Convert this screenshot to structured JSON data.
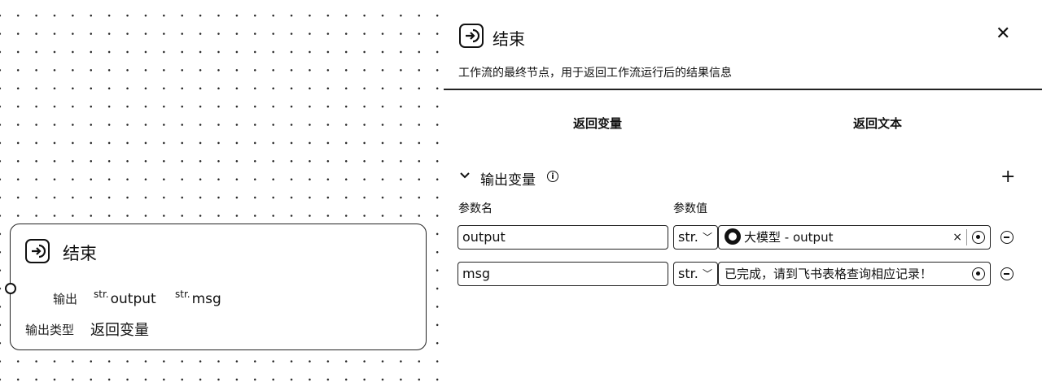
{
  "node": {
    "title": "结束",
    "output_label": "输出",
    "outputs": [
      {
        "type": "str.",
        "name": "output"
      },
      {
        "type": "str.",
        "name": "msg"
      }
    ],
    "output_type_label": "输出类型",
    "output_type_value": "返回变量"
  },
  "panel": {
    "title": "结束",
    "description": "工作流的最终节点，用于返回工作流运行后的结果信息",
    "tabs": [
      "返回变量",
      "返回文本"
    ],
    "section_title": "输出变量",
    "columns": {
      "name": "参数名",
      "value": "参数值"
    },
    "rows": [
      {
        "name": "output",
        "type": "str.",
        "value_source": "大模型",
        "value": "- output"
      },
      {
        "name": "msg",
        "type": "str.",
        "value": "已完成，请到飞书表格查询相应记录！"
      }
    ]
  }
}
